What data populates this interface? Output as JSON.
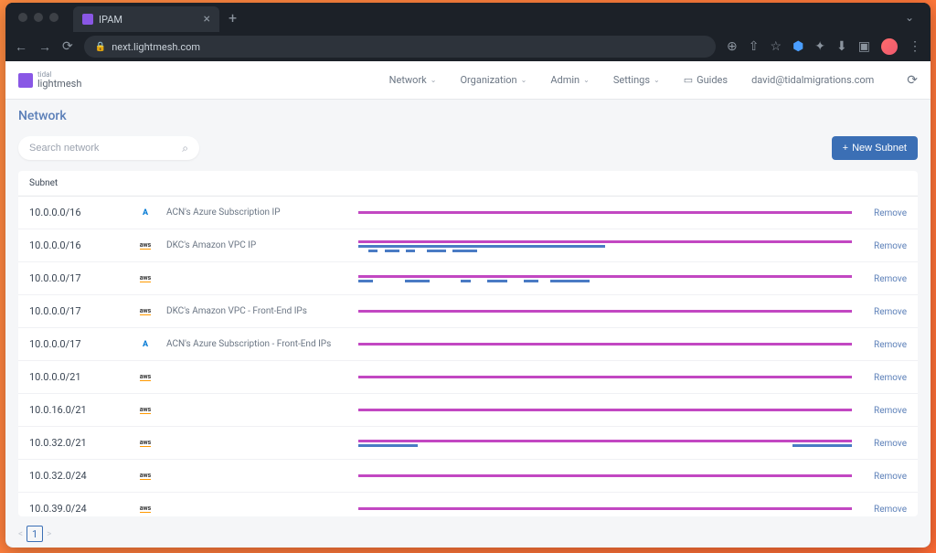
{
  "browser": {
    "tab_title": "IPAM",
    "url": "next.lightmesh.com"
  },
  "logo": {
    "line1": "tidal",
    "line2": "lightmesh"
  },
  "topnav": {
    "network": "Network",
    "organization": "Organization",
    "admin": "Admin",
    "settings": "Settings",
    "guides": "Guides",
    "user_email": "david@tidalmigrations.com"
  },
  "page": {
    "title": "Network"
  },
  "search": {
    "placeholder": "Search network"
  },
  "actions": {
    "new_subnet": "New Subnet"
  },
  "table": {
    "header_subnet": "Subnet",
    "remove_label": "Remove",
    "rows": [
      {
        "cidr": "10.0.0.0/16",
        "provider": "azure",
        "desc": "ACN's Azure Subscription IP",
        "viz": "full"
      },
      {
        "cidr": "10.0.0.0/16",
        "provider": "aws",
        "desc": "DKC's Amazon VPC IP",
        "viz": "half_segs"
      },
      {
        "cidr": "10.0.0.0/17",
        "provider": "aws",
        "desc": "",
        "viz": "full_segs2"
      },
      {
        "cidr": "10.0.0.0/17",
        "provider": "aws",
        "desc": "DKC's Amazon VPC - Front-End IPs",
        "viz": "full"
      },
      {
        "cidr": "10.0.0.0/17",
        "provider": "azure",
        "desc": "ACN's Azure Subscription - Front-End IPs",
        "viz": "full"
      },
      {
        "cidr": "10.0.0.0/21",
        "provider": "aws",
        "desc": "",
        "viz": "full"
      },
      {
        "cidr": "10.0.16.0/21",
        "provider": "aws",
        "desc": "",
        "viz": "full"
      },
      {
        "cidr": "10.0.32.0/21",
        "provider": "aws",
        "desc": "",
        "viz": "full_ends"
      },
      {
        "cidr": "10.0.32.0/24",
        "provider": "aws",
        "desc": "",
        "viz": "full"
      },
      {
        "cidr": "10.0.39.0/24",
        "provider": "aws",
        "desc": "",
        "viz": "full"
      }
    ]
  },
  "pagination": {
    "current": "1"
  }
}
